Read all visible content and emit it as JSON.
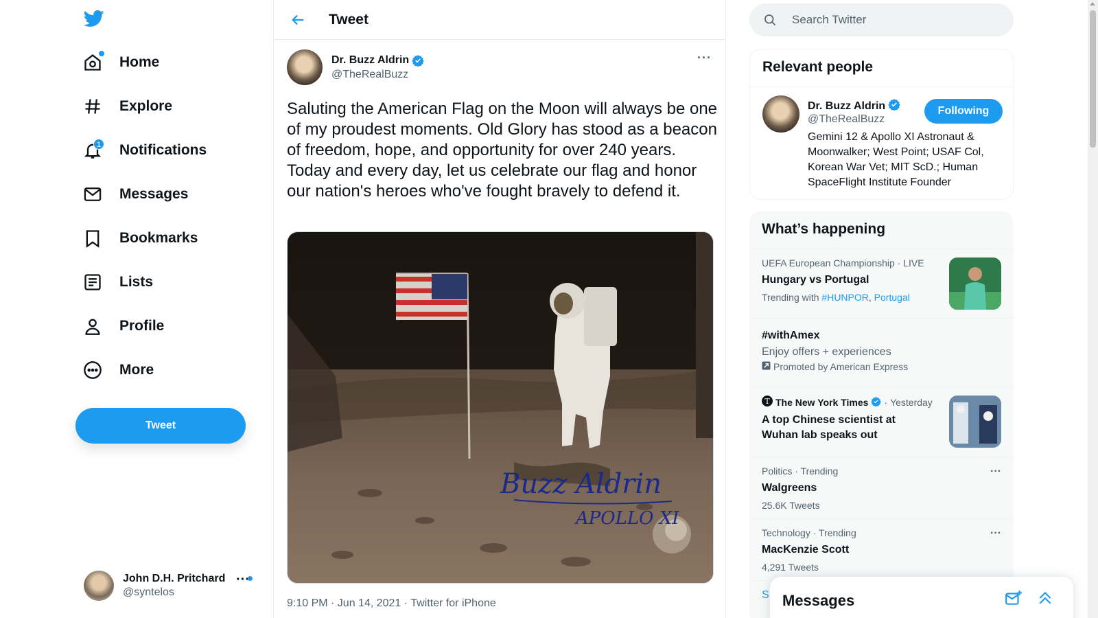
{
  "nav": {
    "items": [
      {
        "label": "Home",
        "icon": "home-icon"
      },
      {
        "label": "Explore",
        "icon": "hashtag-icon"
      },
      {
        "label": "Notifications",
        "icon": "bell-icon",
        "badge": "1"
      },
      {
        "label": "Messages",
        "icon": "envelope-icon"
      },
      {
        "label": "Bookmarks",
        "icon": "bookmark-icon"
      },
      {
        "label": "Lists",
        "icon": "list-icon"
      },
      {
        "label": "Profile",
        "icon": "person-icon"
      },
      {
        "label": "More",
        "icon": "more-circle-icon"
      }
    ],
    "tweet_button": "Tweet",
    "account": {
      "name": "John D.H. Pritchard",
      "handle": "@syntelos"
    }
  },
  "main": {
    "title": "Tweet",
    "tweet": {
      "author_name": "Dr. Buzz Aldrin",
      "author_handle": "@TheRealBuzz",
      "text": "Saluting the American Flag on the Moon will always be one of my proudest moments. Old Glory has stood as a beacon of freedom, hope, and opportunity for over 240 years. Today and every day, let us celebrate our flag and honor our nation's heroes who've fought bravely to defend it.",
      "meta": "9:10 PM · Jun 14, 2021 · Twitter for iPhone",
      "image_signature": "Buzz Aldrin",
      "image_signature_line2": "APOLLO XI"
    }
  },
  "search": {
    "placeholder": "Search Twitter"
  },
  "relevant": {
    "title": "Relevant people",
    "person": {
      "name": "Dr. Buzz Aldrin",
      "handle": "@TheRealBuzz",
      "button": "Following",
      "bio": "Gemini 12 & Apollo XI Astronaut & Moonwalker; West Point; USAF Col, Korean War Vet; MIT ScD.; Human SpaceFlight Institute Founder"
    }
  },
  "happening": {
    "title": "What’s happening",
    "trends": [
      {
        "context": "UEFA European Championship · LIVE",
        "title": "Hungary vs Portugal",
        "sub_prefix": "Trending with",
        "sub_link1": "#HUNPOR",
        "sub_link2": "Portugal"
      },
      {
        "title": "#withAmex",
        "desc": "Enjoy offers + experiences",
        "promoted": "Promoted by American Express"
      },
      {
        "source": "The New York Times",
        "time": "Yesterday",
        "title": "A top Chinese scientist at Wuhan lab speaks out"
      },
      {
        "context": "Politics · Trending",
        "title": "Walgreens",
        "sub": "25.6K Tweets"
      },
      {
        "context": "Technology · Trending",
        "title": "MacKenzie Scott",
        "sub": "4,291 Tweets"
      }
    ],
    "show_more": "S"
  },
  "drawer": {
    "title": "Messages"
  },
  "colors": {
    "accent": "#1d9bf0",
    "text": "#0f1419",
    "secondary": "#536471"
  }
}
